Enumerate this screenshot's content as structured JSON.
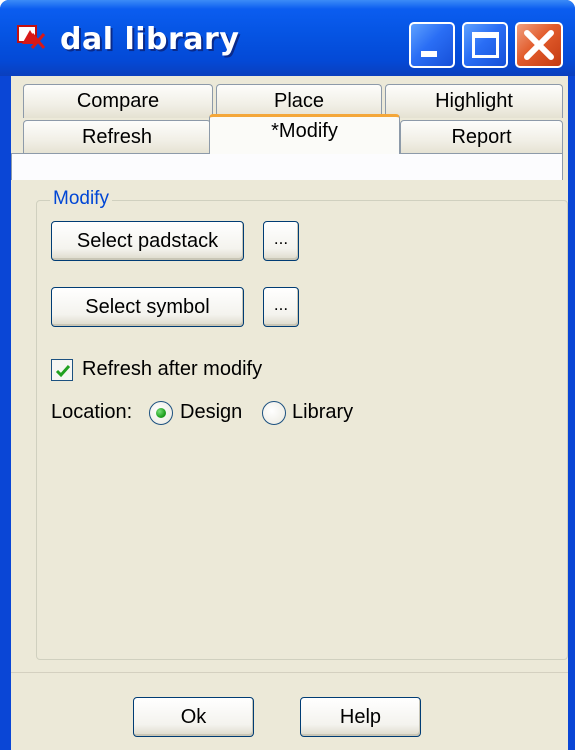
{
  "window": {
    "title": "dal library",
    "icon": "app-icon",
    "controls": [
      "minimize-icon",
      "maximize-icon",
      "close-icon"
    ]
  },
  "tabs": {
    "row1": [
      "Compare",
      "Place",
      "Highlight"
    ],
    "row2": [
      "Refresh",
      "*Modify",
      "Report"
    ],
    "active": "*Modify"
  },
  "modify_group": {
    "label": "Modify",
    "select_padstack": "Select padstack",
    "select_padstack_browse": "...",
    "select_symbol": "Select symbol",
    "select_symbol_browse": "...",
    "refresh_checkbox_label": "Refresh after modify",
    "refresh_checked": true,
    "location_label": "Location:",
    "location_options": [
      "Design",
      "Library"
    ],
    "location_selected": "Design"
  },
  "footer": {
    "ok_label": "Ok",
    "help_label": "Help"
  },
  "colors": {
    "titlebar": "#0554e3",
    "group_label": "#0046d5",
    "active_tab_accent": "#f4a73a",
    "check_mark": "#21a121"
  }
}
